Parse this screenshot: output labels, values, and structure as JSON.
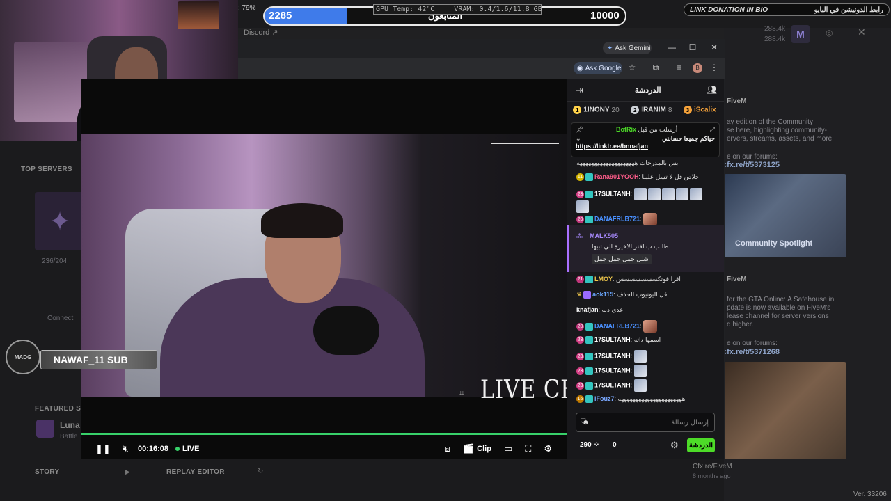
{
  "hud": {
    "cpu_readout": ": 79%",
    "goal_current": "2285",
    "goal_label": "المتابعون",
    "goal_max": "10000",
    "goal_fraction": 0.2285,
    "gpu_temp": "GPU Temp: 42°C",
    "vram": "VRAM: 0.4/1.6/11.8 GB",
    "donation_text_en": "LINK DONATION IN BIO",
    "donation_text_ar": "رابط الدونيشن في البايو"
  },
  "bg": {
    "discord": "Discord",
    "count1": "288.4k",
    "count2": "288.4k",
    "top_servers": "TOP SERVERS",
    "server_count": "236/204",
    "connect": "Connect",
    "featured": "FEATURED SE",
    "featured_name": "Luna",
    "featured_sub": "Battle",
    "story": "STORY",
    "replay": "REPLAY EDITOR",
    "news1_title": "FiveM",
    "news1_body": "ay edition of the Community\nse here, highlighting community-\nervers, streams, assets, and more!",
    "news1_forum": "e on our forums:",
    "news1_link": "cfx.re/t/5373125",
    "spotlight": "Community Spotlight",
    "news2_title": "FiveM",
    "news2_body": "for the GTA Online: A Safehouse in\npdate is now available on FiveM's\nlease channel for server versions\nd higher.",
    "news2_forum": "e on our forums:",
    "news2_link": "cfx.re/t/5371268",
    "foot_link": "Cfx.re/FiveM",
    "foot_time": "8 months ago",
    "version": "Ver. 33206"
  },
  "browser": {
    "ask_gemini": "Ask Gemini",
    "ask_google": "Ask Google",
    "profile_initial": "B"
  },
  "player": {
    "time": "00:16:08",
    "live": "LIVE",
    "clip": "Clip",
    "overlay_text": "LIVE CHAT",
    "progress": 1.0
  },
  "sub_alert": {
    "logo_text": "MADG",
    "text": "NAWAF_11 SUB"
  },
  "chat": {
    "title": "الدردشة",
    "leaderboard": [
      {
        "rank": "1",
        "name": "1INONY",
        "score": "20",
        "color": "#ffd24a"
      },
      {
        "rank": "2",
        "name": "IRANIM",
        "score": "8",
        "color": "#cfd3d8"
      },
      {
        "rank": "3",
        "name": "iScalix",
        "score": "",
        "color": "#f5a23a"
      }
    ],
    "pinned": {
      "author": "BotRix",
      "header": "أرسلت من قبل",
      "line": "حياكم جميعا حسابتي",
      "link": "https://linktr.ee/bnnafjan"
    },
    "messages": [
      {
        "badge": "",
        "name": "",
        "text": "بس بالمدرجات ههههههههههههههههههههه",
        "color": "#ddd"
      },
      {
        "badge": "11",
        "name": "Rana901YOOH",
        "text": "خلاص قل لا تسل علينا",
        "color": "#ff5c8a"
      },
      {
        "badge": "23",
        "name": "17SULTANH",
        "text": "",
        "color": "#ffffff"
      },
      {
        "badge": "20",
        "name": "DANAFRLB721",
        "text": "",
        "color": "#4a90ff"
      },
      {
        "badge": "",
        "name": "MALK505",
        "text": "طالب ب لقتر الاخيرة الي تبيها",
        "text2": "شلل جمل جمل جمل",
        "color": "#a98bff"
      },
      {
        "badge": "21",
        "name": "LMOY",
        "text": "اقرا قوتكسسسسسسس",
        "color": "#f2c94c"
      },
      {
        "badge": "",
        "name": "aok115",
        "text": "قل اليوتيوب الحذف",
        "color": "#6aa7ff"
      },
      {
        "badge": "",
        "name": "knafjan",
        "text": "عدي ذبه",
        "color": "#ffffff"
      },
      {
        "badge": "20",
        "name": "DANAFRLB721",
        "text": "",
        "color": "#4a90ff"
      },
      {
        "badge": "23",
        "name": "17SULTANH",
        "text": "اسمها داته",
        "color": "#ffffff"
      },
      {
        "badge": "23",
        "name": "17SULTANH",
        "text": "",
        "color": "#ffffff"
      },
      {
        "badge": "23",
        "name": "17SULTANH",
        "text": "",
        "color": "#ffffff"
      },
      {
        "badge": "23",
        "name": "17SULTANH",
        "text": "",
        "color": "#ffffff"
      },
      {
        "badge": "16",
        "name": "iFouz7",
        "text": "ههههههههههههههههههههههه",
        "color": "#7aa8ff"
      }
    ],
    "input_placeholder": "إرسال رسالة",
    "points": "290",
    "viewers": "0",
    "send_label": "الدردشة"
  }
}
